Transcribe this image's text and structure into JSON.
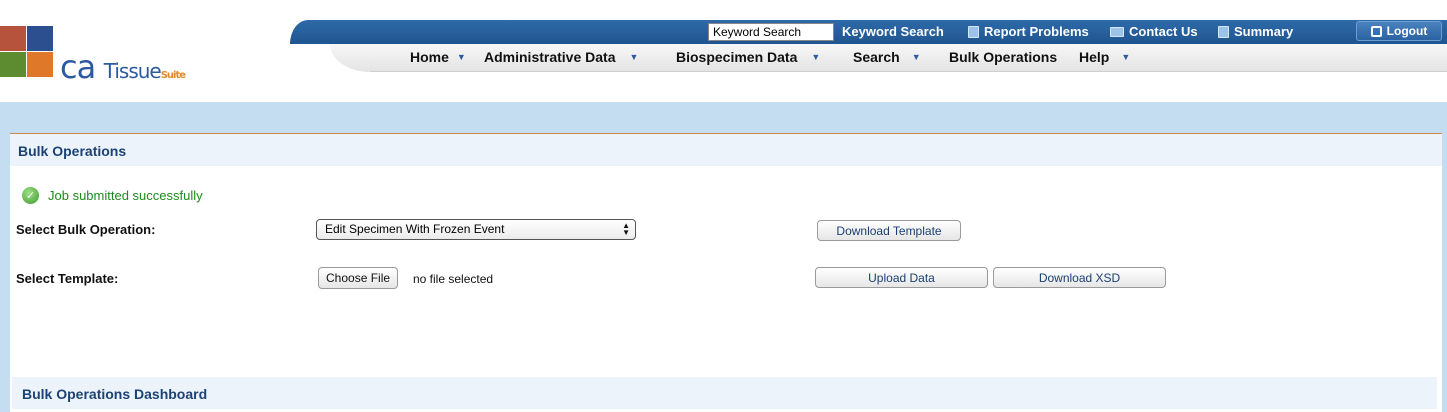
{
  "header": {
    "logo": {
      "brand": "ca",
      "name": "Tissue",
      "suite": "Suite"
    },
    "keyword_search_value": "Keyword Search",
    "links": {
      "keyword_search": "Keyword Search",
      "report_problems": "Report Problems",
      "contact_us": "Contact Us",
      "summary": "Summary",
      "logout": "Logout"
    },
    "menu": {
      "home": "Home",
      "administrative_data": "Administrative Data",
      "biospecimen_data": "Biospecimen Data",
      "search": "Search",
      "bulk_operations": "Bulk Operations",
      "help": "Help"
    }
  },
  "main": {
    "title": "Bulk Operations",
    "success_message": "Job submitted successfully",
    "select_operation_label": "Select Bulk Operation:",
    "select_operation_value": "Edit Specimen With Frozen Event",
    "download_template": "Download Template",
    "select_template_label": "Select Template:",
    "choose_file": "Choose File",
    "no_file": "no file selected",
    "upload_data": "Upload Data",
    "download_xsd": "Download XSD",
    "dashboard_title": "Bulk Operations Dashboard"
  },
  "colors": {
    "accent_blue": "#1f5591",
    "title_blue": "#1b4274",
    "success_green": "#1e8a1e",
    "band": "#c5ddf0"
  }
}
